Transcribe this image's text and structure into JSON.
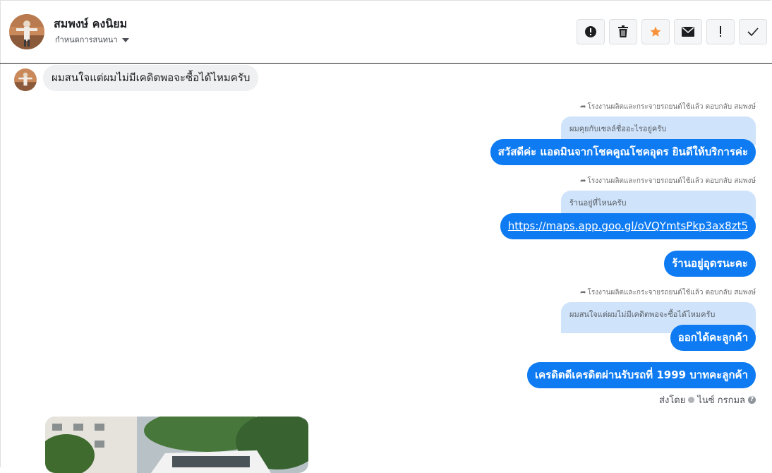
{
  "header": {
    "contact_name": "สมพงษ์ คงนิยม",
    "assign_label": "กำหนดการสนทนา",
    "actions": [
      {
        "icon": "alert-circle-icon",
        "name": "mark-spam-button"
      },
      {
        "icon": "trash-icon",
        "name": "delete-button"
      },
      {
        "icon": "star-icon",
        "name": "star-button",
        "color": "#f7923a"
      },
      {
        "icon": "envelope-icon",
        "name": "mark-unread-button"
      },
      {
        "icon": "exclamation-icon",
        "name": "follow-up-button"
      },
      {
        "icon": "check-icon",
        "name": "done-button"
      }
    ]
  },
  "messages": {
    "incoming_1": "ผมสนใจแต่ผมไม่มีเคดิตพอจะซื้อได้ไหมครับ",
    "reply_note": "โรงงานผลิตและกระจายรถยนต์ใช้แล้ว ตอบกลับ สมพงษ์",
    "quote_1": "ผมคุยกับเซลล์ชื่ออะไรอยู่ครับ",
    "out_1": "สวัสดีค่ะ แอดมินจากโชคคูณโชคอุดร ยินดีให้บริการค่ะ",
    "quote_2": "ร้านอยู่ที่ไหนครับ",
    "out_2": "https://maps.app.goo.gl/oVQYmtsPkp3ax8zt5",
    "out_3": "ร้านอยู่อุดรนะคะ",
    "quote_3": "ผมสนใจแต่ผมไม่มีเคดิตพอจะซื้อได้ไหมครับ",
    "out_4": "ออกได้คะลูกค้า",
    "out_5": "เครดิตดีเครดิตผ่านรับรถที่ 1999 บาทคะลูกค้า",
    "sent_by_label": "ส่งโดย",
    "sent_by_name": "ไนซ์ กรกมล"
  },
  "colors": {
    "outgoing_bubble": "#0e7bf2",
    "quote_bubble": "#cfe3fb",
    "incoming_bubble": "#eff0f2",
    "star": "#f7923a"
  }
}
